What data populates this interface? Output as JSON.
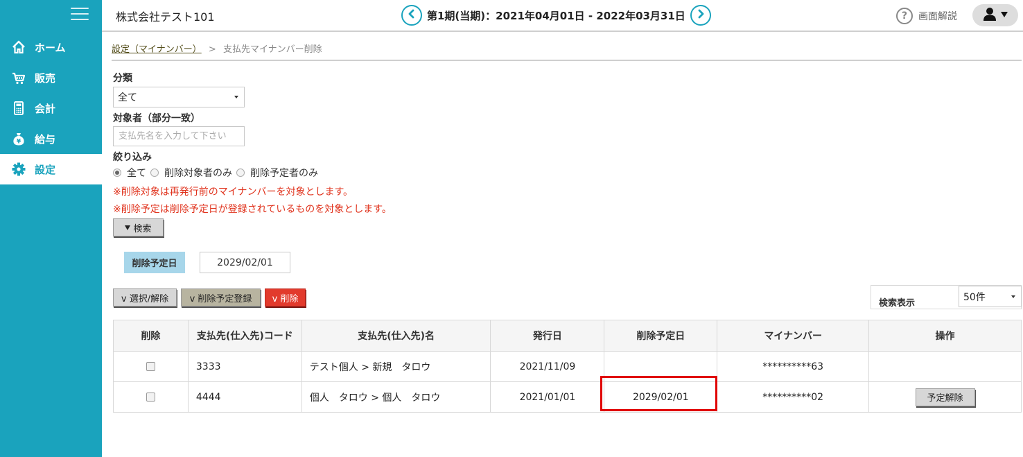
{
  "header": {
    "company": "株式会社テスト101",
    "period": "第1期(当期)：2021年04月01日 - 2022年03月31日",
    "help_label": "画面解説"
  },
  "sidebar": {
    "items": [
      {
        "label": "ホーム",
        "icon": "home-icon"
      },
      {
        "label": "販売",
        "icon": "cart-icon"
      },
      {
        "label": "会計",
        "icon": "calculator-icon"
      },
      {
        "label": "給与",
        "icon": "money-bag-icon"
      },
      {
        "label": "設定",
        "icon": "gear-icon",
        "active": true
      }
    ]
  },
  "breadcrumb": {
    "parent": "設定（マイナンバー）",
    "separator": ">",
    "current": "支払先マイナンバー削除"
  },
  "form": {
    "category_label": "分類",
    "category_value": "全て",
    "target_label": "対象者（部分一致）",
    "target_placeholder": "支払先名を入力して下さい",
    "filter_label": "絞り込み",
    "filter_options": [
      "全て",
      "削除対象者のみ",
      "削除予定者のみ"
    ],
    "note1": "※削除対象は再発行前のマイナンバーを対象とします。",
    "note2": "※削除予定は削除予定日が登録されているものを対象とします。",
    "search_button": "検索"
  },
  "schedule": {
    "label": "削除予定日",
    "value": "2029/02/01"
  },
  "actions": {
    "select_toggle": "v 選択/解除",
    "register": "v 削除予定登録",
    "delete": "v 削除"
  },
  "display": {
    "label": "検索表示",
    "value": "50件"
  },
  "table": {
    "headers": [
      "削除",
      "支払先(仕入先)コード",
      "支払先(仕入先)名",
      "発行日",
      "削除予定日",
      "マイナンバー",
      "操作"
    ],
    "rows": [
      {
        "code": "3333",
        "name": "テスト個人 > 新規　タロウ",
        "issued": "2021/11/09",
        "scheduled": "",
        "mynumber": "**********63",
        "action": ""
      },
      {
        "code": "4444",
        "name": "個人　タロウ > 個人　タロウ",
        "issued": "2021/01/01",
        "scheduled": "2029/02/01",
        "mynumber": "**********02",
        "action": "予定解除"
      }
    ]
  },
  "colors": {
    "sidebar": "#1aa3bd",
    "note": "#e0321c",
    "delete_button": "#e23a2c",
    "highlight": "#e00000"
  }
}
